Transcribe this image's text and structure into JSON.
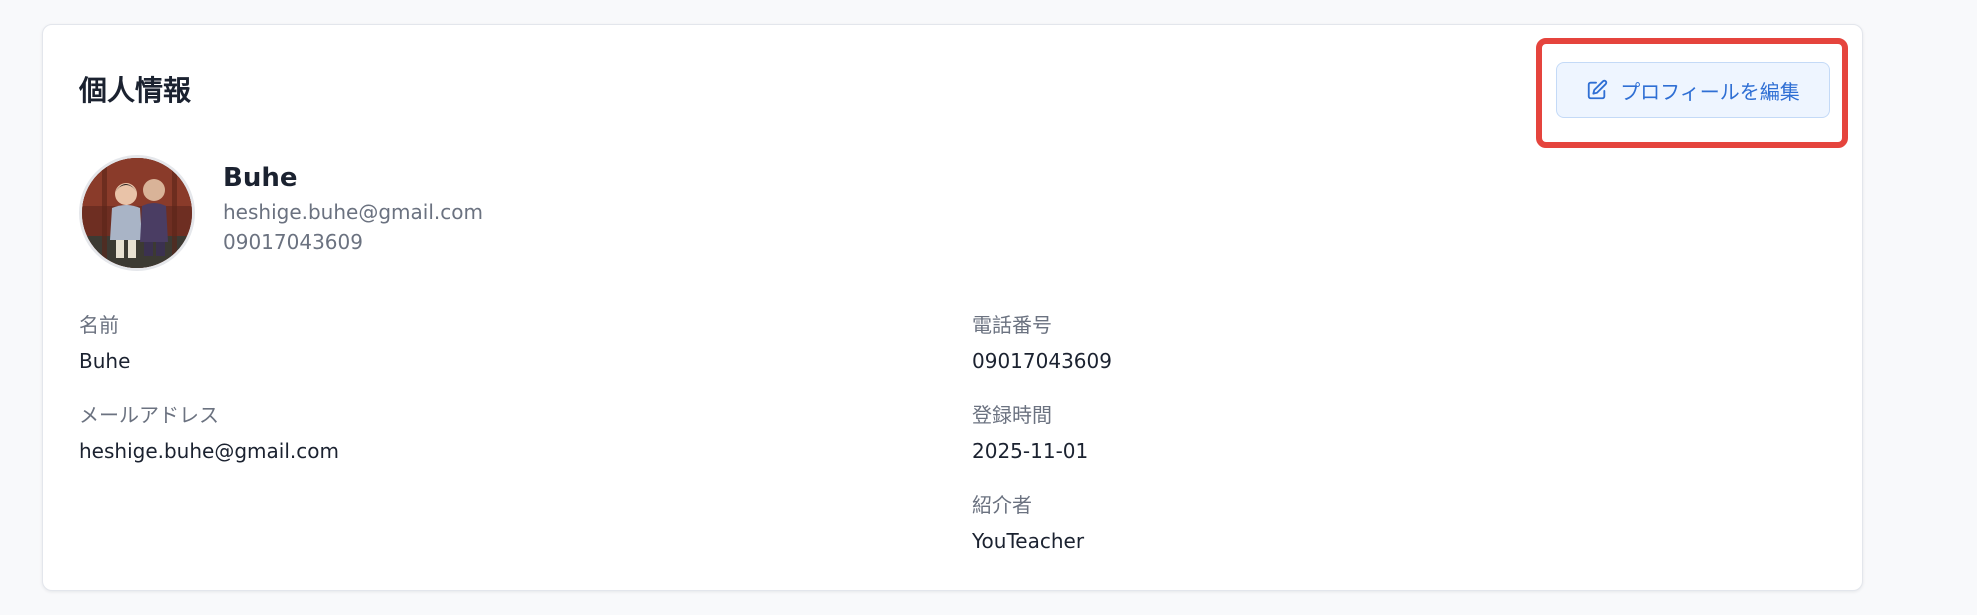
{
  "profile_card": {
    "title": "個人情報",
    "edit_button_label": "プロフィールを編集",
    "user": {
      "name": "Buhe",
      "email": "heshige.buhe@gmail.com",
      "phone": "09017043609"
    },
    "fields": {
      "name": {
        "label": "名前",
        "value": "Buhe"
      },
      "phone": {
        "label": "電話番号",
        "value": "09017043609"
      },
      "email": {
        "label": "メールアドレス",
        "value": "heshige.buhe@gmail.com"
      },
      "registered": {
        "label": "登録時間",
        "value": "2025-11-01"
      },
      "referrer": {
        "label": "紹介者",
        "value": "YouTeacher"
      }
    }
  },
  "icons": {
    "edit_button_icon": "edit-icon"
  },
  "colors": {
    "accent": "#2f6fd4",
    "highlight": "#e5443d"
  }
}
